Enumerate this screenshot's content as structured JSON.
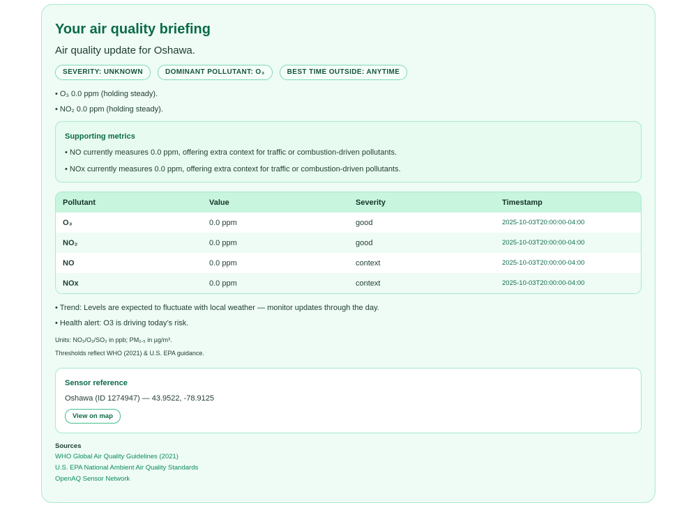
{
  "briefing": {
    "title": "Your air quality briefing",
    "subtitle": "Air quality update for Oshawa.",
    "badges": [
      "SEVERITY: UNKNOWN",
      "DOMINANT POLLUTANT: O₃",
      "BEST TIME OUTSIDE: ANYTIME"
    ],
    "bullets": [
      "• O₃ 0.0 ppm (holding steady).",
      "• NO₂ 0.0 ppm (holding steady)."
    ]
  },
  "supporting": {
    "title": "Supporting metrics",
    "items": [
      "• NO currently measures 0.0 ppm, offering extra context for traffic or combustion-driven pollutants.",
      "• NOx currently measures 0.0 ppm, offering extra context for traffic or combustion-driven pollutants."
    ]
  },
  "table": {
    "headers": [
      "Pollutant",
      "Value",
      "Severity",
      "Timestamp"
    ],
    "rows": [
      {
        "pollutant": "O₃",
        "value": "0.0 ppm",
        "severity": "good",
        "timestamp": "2025-10-03T20:00:00-04:00"
      },
      {
        "pollutant": "NO₂",
        "value": "0.0 ppm",
        "severity": "good",
        "timestamp": "2025-10-03T20:00:00-04:00"
      },
      {
        "pollutant": "NO",
        "value": "0.0 ppm",
        "severity": "context",
        "timestamp": "2025-10-03T20:00:00-04:00"
      },
      {
        "pollutant": "NOx",
        "value": "0.0 ppm",
        "severity": "context",
        "timestamp": "2025-10-03T20:00:00-04:00"
      }
    ]
  },
  "notes": [
    "• Trend: Levels are expected to fluctuate with local weather — monitor updates through the day.",
    "• Health alert: O3 is driving today’s risk."
  ],
  "units": {
    "line1": "Units: NO₂/O₃/SO₂ in ppb; PM₂.₅ in µg/m³.",
    "line2": "Thresholds reflect WHO (2021) & U.S. EPA guidance."
  },
  "sensor": {
    "title": "Sensor reference",
    "text": "Oshawa (ID 1274947) — 43.9522, -78.9125",
    "button": "View on map"
  },
  "sources": {
    "title": "Sources",
    "links": [
      "WHO Global Air Quality Guidelines (2021)",
      "U.S. EPA National Ambient Air Quality Standards",
      "OpenAQ Sensor Network"
    ]
  },
  "colors": {
    "accent": "#0b6b48",
    "panel_bg": "#eefcf5",
    "border": "#a9e9cc",
    "table_header": "#c8f5de"
  }
}
